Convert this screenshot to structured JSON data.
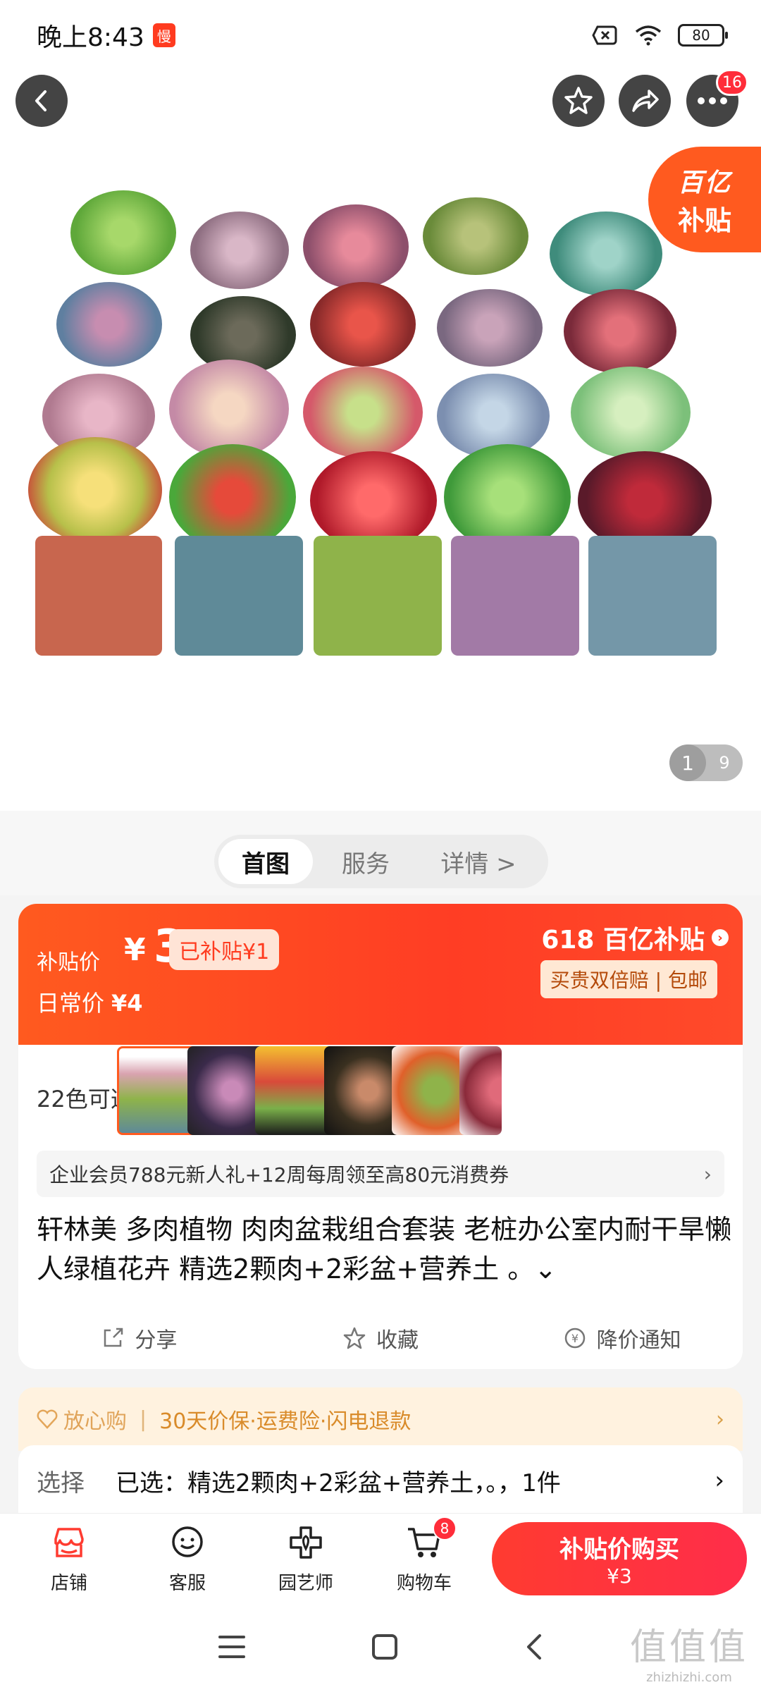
{
  "status_bar": {
    "time": "晚上8:43",
    "app_badge": "慢",
    "battery": "80"
  },
  "header": {
    "more_badge": "16"
  },
  "hero": {
    "subsidy_l1": "百亿",
    "subsidy_l2": "补贴",
    "pager_current": "1",
    "pager_total": "9"
  },
  "tabs": [
    {
      "label": "首图"
    },
    {
      "label": "服务"
    },
    {
      "label": "详情 >"
    }
  ],
  "price": {
    "label": "补贴价",
    "currency": "¥",
    "value": "3",
    "subsidy_pill": "已补贴¥1",
    "daily_label": "日常价",
    "daily_value": "¥4",
    "brand": "618 百亿补贴",
    "promo": "买贵双倍赔 | 包邮"
  },
  "variants": {
    "count_label": "22色可选"
  },
  "member_bar": {
    "text": "企业会员788元新人礼+12周每周领至高80元消费券",
    "chev": "›"
  },
  "product": {
    "title": "轩林美 多肉植物 肉肉盆栽组合套装 老桩办公室内耐干旱懒人绿植花卉 精选2颗肉+2彩盆+营养土 。⌄"
  },
  "actions": [
    {
      "label": "分享"
    },
    {
      "label": "收藏"
    },
    {
      "label": "降价通知"
    }
  ],
  "assurance": {
    "brand": "放心购",
    "sep": "|",
    "text": "30天价保·运费险·闪电退款",
    "chev": "›"
  },
  "select": {
    "key": "选择",
    "value": "已选：精选2颗肉+2彩盆+营养土，。，1件",
    "chev": "›"
  },
  "bottom_nav": [
    {
      "label": "店铺"
    },
    {
      "label": "客服"
    },
    {
      "label": "园艺师"
    },
    {
      "label": "购物车",
      "badge": "8"
    }
  ],
  "buy": {
    "title": "补贴价购买",
    "price": "¥3"
  },
  "watermark": {
    "big": "值值值",
    "small": "zhizhizhi.com"
  },
  "colors": {
    "accent": "#ff3b1f",
    "brand_orange": "#ff5a1f"
  }
}
